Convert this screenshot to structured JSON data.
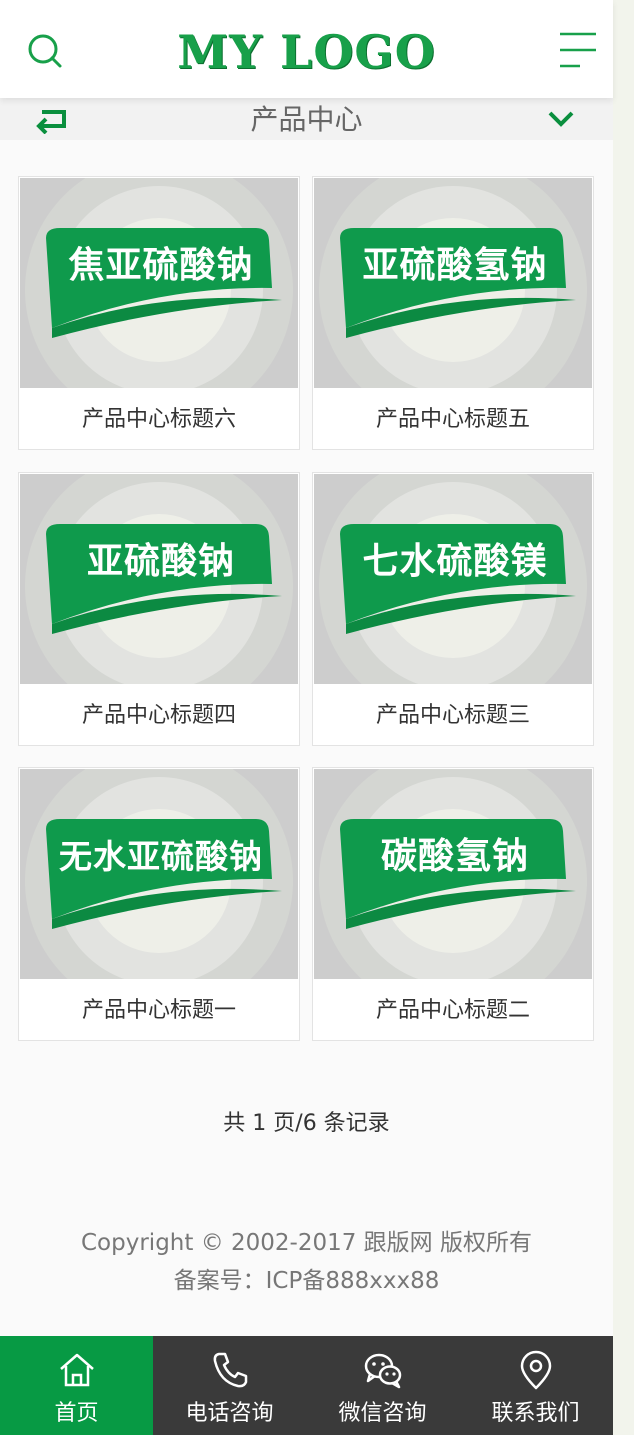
{
  "header": {
    "logo": "MY LOGO",
    "search_icon": "search-icon",
    "menu_icon": "menu-icon"
  },
  "subbar": {
    "title": "产品中心",
    "back_icon": "return-arrow-icon",
    "dropdown_icon": "chevron-down-icon"
  },
  "products": [
    {
      "badge": "焦亚硫酸钠",
      "caption": "产品中心标题六"
    },
    {
      "badge": "亚硫酸氢钠",
      "caption": "产品中心标题五"
    },
    {
      "badge": "亚硫酸钠",
      "caption": "产品中心标题四"
    },
    {
      "badge": "七水硫酸镁",
      "caption": "产品中心标题三"
    },
    {
      "badge": "无水亚硫酸钠",
      "caption": "产品中心标题一"
    },
    {
      "badge": "碳酸氢钠",
      "caption": "产品中心标题二"
    }
  ],
  "pagination": {
    "text": "共 1 页/6 条记录"
  },
  "footer": {
    "copyright": "Copyright © 2002-2017 跟版网 版权所有",
    "icp": "备案号：ICP备888xxx88"
  },
  "bottom_nav": [
    {
      "label": "首页",
      "icon": "home-icon",
      "active": true
    },
    {
      "label": "电话咨询",
      "icon": "phone-icon",
      "active": false
    },
    {
      "label": "微信咨询",
      "icon": "wechat-icon",
      "active": false
    },
    {
      "label": "联系我们",
      "icon": "location-pin-icon",
      "active": false
    }
  ],
  "colors": {
    "brand_green": "#18a04a",
    "active_nav": "#079a44",
    "nav_background": "#3a3a3a"
  }
}
